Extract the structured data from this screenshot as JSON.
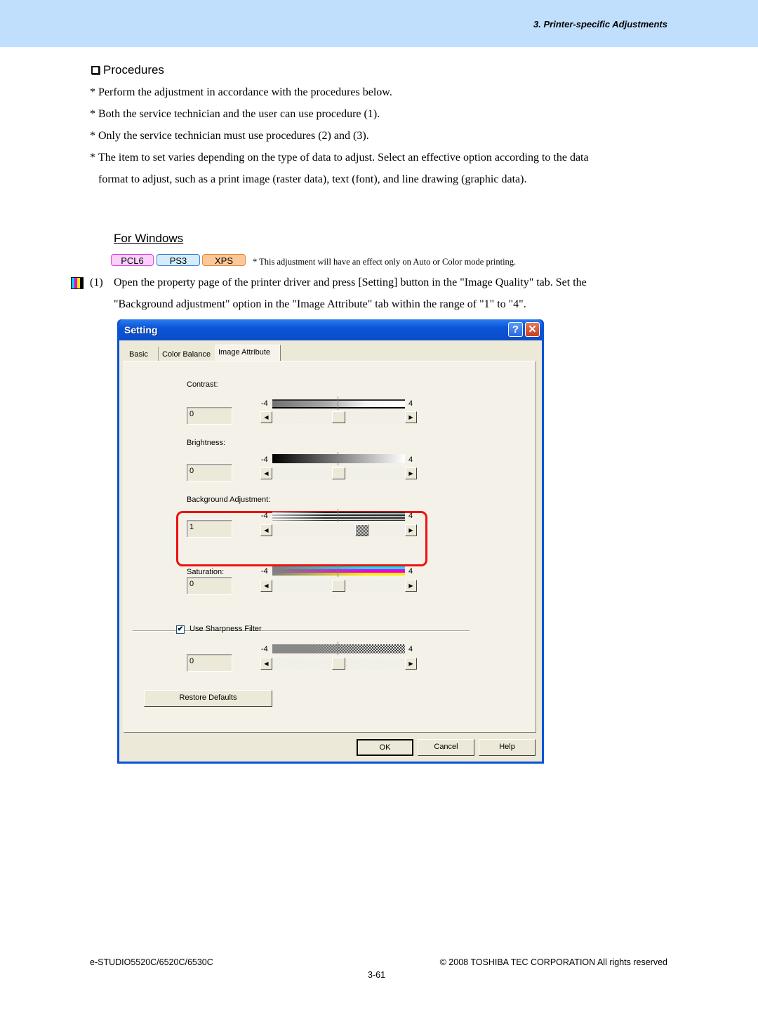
{
  "header": {
    "section_title": "3. Printer-specific Adjustments",
    "band_color": "#c0dffc"
  },
  "procedures": {
    "heading": "Procedures",
    "heading_icon": "checkbox-square-icon",
    "bullets": [
      {
        "star": "*",
        "text": "Perform the adjustment in accordance with the procedures below."
      },
      {
        "star": "*",
        "text": "Both the service technician and the user can use procedure (1)."
      },
      {
        "star": "*",
        "text": "Only the service technician must use procedures (2) and (3)."
      },
      {
        "star": "*",
        "text": "The item to set varies depending on the type of data to adjust.  Select an effective option according to the data",
        "continuation": "format to adjust, such as a print image (raster data), text (font), and line drawing (graphic data)."
      }
    ]
  },
  "windows_section": {
    "heading": "For Windows",
    "badges": [
      {
        "label": "PCL6",
        "color": "#fbd0fb"
      },
      {
        "label": "PS3",
        "color": "#d4ecfc"
      },
      {
        "label": "XPS",
        "color": "#fcc898"
      }
    ],
    "note": "* This adjustment will have an effect only on Auto or Color mode printing.",
    "step": {
      "icon": "cmyk-stripes-icon",
      "number": "(1)",
      "line1": "Open the property page of the printer driver and press [Setting] button in the \"Image Quality\" tab. Set the",
      "line2": "\"Background adjustment\" option in the \"Image Attribute\" tab within the range of \"1\" to \"4\"."
    }
  },
  "dialog": {
    "title": "Setting",
    "help_glyph": "?",
    "close_glyph": "✕",
    "tabs": [
      {
        "label": "Basic",
        "active": false
      },
      {
        "label": "Color Balance",
        "active": false
      },
      {
        "label": "Image Attribute",
        "active": true
      }
    ],
    "sliders": [
      {
        "label": "Contrast:",
        "value": "0",
        "min": "-4",
        "max": "4",
        "position": 0
      },
      {
        "label": "Brightness:",
        "value": "0",
        "min": "-4",
        "max": "4",
        "position": 0
      },
      {
        "label": "Background Adjustment:",
        "value": "1",
        "min": "-4",
        "max": "4",
        "position": 1,
        "highlighted": true
      },
      {
        "label": "Saturation:",
        "value": "0",
        "min": "-4",
        "max": "4",
        "position": 0
      }
    ],
    "sharpness": {
      "checkbox_label": "Use Sharpness Filter",
      "checked": true,
      "check_glyph": "✔",
      "value": "0",
      "min": "-4",
      "max": "4",
      "position": 0
    },
    "arrow_left": "◀",
    "arrow_right": "▶",
    "restore_defaults": "Restore Defaults",
    "buttons": {
      "ok": "OK",
      "cancel": "Cancel",
      "help": "Help"
    },
    "highlight_color": "#ee1111"
  },
  "footer": {
    "model": "e-STUDIO5520C/6520C/6530C",
    "copyright": "© 2008 TOSHIBA TEC CORPORATION All rights reserved",
    "page": "3-61"
  }
}
